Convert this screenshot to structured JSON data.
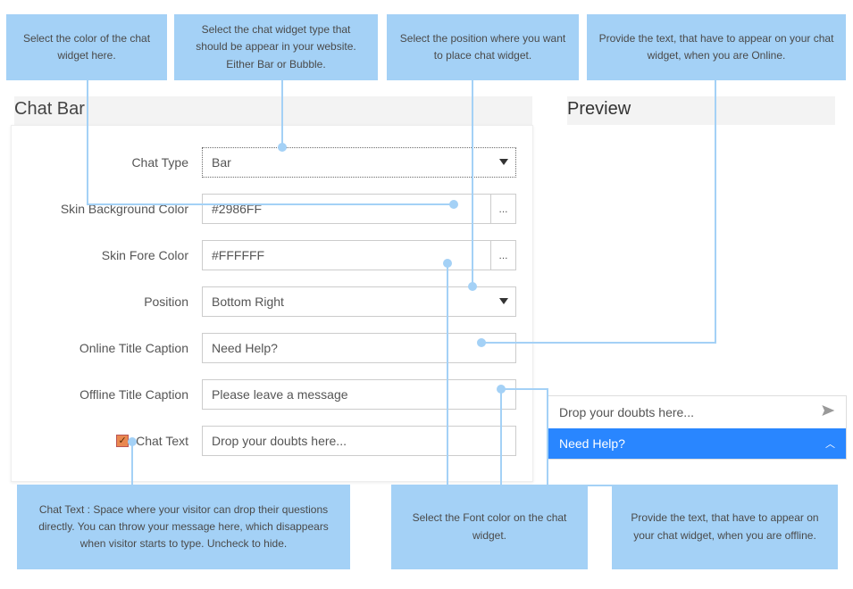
{
  "callouts": {
    "top1": "Select the color of the chat widget here.",
    "top2": "Select the chat widget type that should be appear in your website. Either Bar or Bubble.",
    "top3": "Select the position where you want to place chat widget.",
    "top4": "Provide the text, that have to appear on your chat widget, when you are Online.",
    "bot1": "Chat Text : Space where your visitor can drop their questions directly. You can throw your message here, which disappears when visitor starts to type. Uncheck to hide.",
    "bot2": "Select the Font color on the chat widget.",
    "bot3": "Provide the text, that have to appear on your chat widget, when you are offline."
  },
  "headers": {
    "panel": "Chat Bar",
    "preview": "Preview"
  },
  "form": {
    "chat_type": {
      "label": "Chat Type",
      "value": "Bar"
    },
    "bg_color": {
      "label": "Skin Background Color",
      "value": "#2986FF",
      "btn": "..."
    },
    "fore_color": {
      "label": "Skin Fore Color",
      "value": "#FFFFFF",
      "btn": "..."
    },
    "position": {
      "label": "Position",
      "value": "Bottom Right"
    },
    "online_caption": {
      "label": "Online Title Caption",
      "value": "Need Help?"
    },
    "offline_caption": {
      "label": "Offline Title Caption",
      "value": "Please leave a message"
    },
    "chat_text": {
      "label": "Chat Text",
      "value": "Drop your doubts here..."
    }
  },
  "preview": {
    "placeholder": "Drop your doubts here...",
    "title": "Need Help?"
  }
}
